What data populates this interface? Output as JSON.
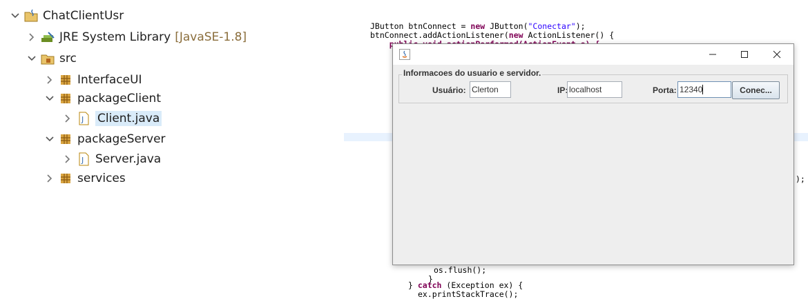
{
  "tree": {
    "project": "ChatClientUsr",
    "jre": "JRE System Library",
    "jre_version": "[JavaSE-1.8]",
    "src": "src",
    "packages": {
      "interface_ui": "InterfaceUI",
      "package_client": "packageClient",
      "client_java": "Client.java",
      "package_server": "packageServer",
      "server_java": "Server.java",
      "services": "services"
    }
  },
  "code": {
    "line1_a": "JButton btnConnect = ",
    "line1_kw": "new",
    "line1_b": " JButton(",
    "line1_str": "\"Conectar\"",
    "line1_c": ");",
    "line2_a": "btnConnect.addActionListener(",
    "line2_kw": "new",
    "line2_b": " ActionListener() {",
    "line3": "    public void actionPerformed(ActionEvent e) {",
    "right_fragment": ");",
    "flush": "os.flush();",
    "close_brace": "}",
    "catch_a": "} ",
    "catch_kw": "catch",
    "catch_b": " (Exception ex) {",
    "trace": "ex.printStackTrace();"
  },
  "window": {
    "panel_title": "Informacoes do usuario e servidor.",
    "user_label": "Usuário:",
    "user_value": "Clerton",
    "ip_label": "IP:",
    "ip_value": "localhost",
    "port_label": "Porta:",
    "port_value": "12340",
    "connect_button": "Conec...",
    "minimize": "—",
    "maximize": "☐",
    "close": "✕"
  }
}
